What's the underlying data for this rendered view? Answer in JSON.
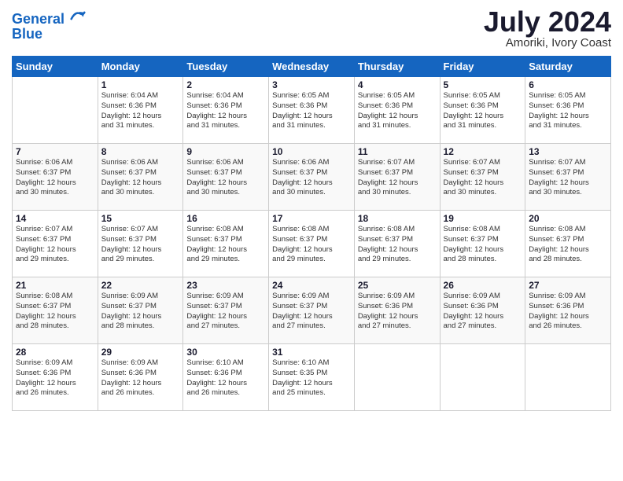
{
  "header": {
    "logo_line1": "General",
    "logo_line2": "Blue",
    "month_year": "July 2024",
    "location": "Amoriki, Ivory Coast"
  },
  "weekdays": [
    "Sunday",
    "Monday",
    "Tuesday",
    "Wednesday",
    "Thursday",
    "Friday",
    "Saturday"
  ],
  "weeks": [
    [
      {
        "day": "",
        "info": ""
      },
      {
        "day": "1",
        "info": "Sunrise: 6:04 AM\nSunset: 6:36 PM\nDaylight: 12 hours\nand 31 minutes."
      },
      {
        "day": "2",
        "info": "Sunrise: 6:04 AM\nSunset: 6:36 PM\nDaylight: 12 hours\nand 31 minutes."
      },
      {
        "day": "3",
        "info": "Sunrise: 6:05 AM\nSunset: 6:36 PM\nDaylight: 12 hours\nand 31 minutes."
      },
      {
        "day": "4",
        "info": "Sunrise: 6:05 AM\nSunset: 6:36 PM\nDaylight: 12 hours\nand 31 minutes."
      },
      {
        "day": "5",
        "info": "Sunrise: 6:05 AM\nSunset: 6:36 PM\nDaylight: 12 hours\nand 31 minutes."
      },
      {
        "day": "6",
        "info": "Sunrise: 6:05 AM\nSunset: 6:36 PM\nDaylight: 12 hours\nand 31 minutes."
      }
    ],
    [
      {
        "day": "7",
        "info": "Sunrise: 6:06 AM\nSunset: 6:37 PM\nDaylight: 12 hours\nand 30 minutes."
      },
      {
        "day": "8",
        "info": "Sunrise: 6:06 AM\nSunset: 6:37 PM\nDaylight: 12 hours\nand 30 minutes."
      },
      {
        "day": "9",
        "info": "Sunrise: 6:06 AM\nSunset: 6:37 PM\nDaylight: 12 hours\nand 30 minutes."
      },
      {
        "day": "10",
        "info": "Sunrise: 6:06 AM\nSunset: 6:37 PM\nDaylight: 12 hours\nand 30 minutes."
      },
      {
        "day": "11",
        "info": "Sunrise: 6:07 AM\nSunset: 6:37 PM\nDaylight: 12 hours\nand 30 minutes."
      },
      {
        "day": "12",
        "info": "Sunrise: 6:07 AM\nSunset: 6:37 PM\nDaylight: 12 hours\nand 30 minutes."
      },
      {
        "day": "13",
        "info": "Sunrise: 6:07 AM\nSunset: 6:37 PM\nDaylight: 12 hours\nand 30 minutes."
      }
    ],
    [
      {
        "day": "14",
        "info": "Sunrise: 6:07 AM\nSunset: 6:37 PM\nDaylight: 12 hours\nand 29 minutes."
      },
      {
        "day": "15",
        "info": "Sunrise: 6:07 AM\nSunset: 6:37 PM\nDaylight: 12 hours\nand 29 minutes."
      },
      {
        "day": "16",
        "info": "Sunrise: 6:08 AM\nSunset: 6:37 PM\nDaylight: 12 hours\nand 29 minutes."
      },
      {
        "day": "17",
        "info": "Sunrise: 6:08 AM\nSunset: 6:37 PM\nDaylight: 12 hours\nand 29 minutes."
      },
      {
        "day": "18",
        "info": "Sunrise: 6:08 AM\nSunset: 6:37 PM\nDaylight: 12 hours\nand 29 minutes."
      },
      {
        "day": "19",
        "info": "Sunrise: 6:08 AM\nSunset: 6:37 PM\nDaylight: 12 hours\nand 28 minutes."
      },
      {
        "day": "20",
        "info": "Sunrise: 6:08 AM\nSunset: 6:37 PM\nDaylight: 12 hours\nand 28 minutes."
      }
    ],
    [
      {
        "day": "21",
        "info": "Sunrise: 6:08 AM\nSunset: 6:37 PM\nDaylight: 12 hours\nand 28 minutes."
      },
      {
        "day": "22",
        "info": "Sunrise: 6:09 AM\nSunset: 6:37 PM\nDaylight: 12 hours\nand 28 minutes."
      },
      {
        "day": "23",
        "info": "Sunrise: 6:09 AM\nSunset: 6:37 PM\nDaylight: 12 hours\nand 27 minutes."
      },
      {
        "day": "24",
        "info": "Sunrise: 6:09 AM\nSunset: 6:37 PM\nDaylight: 12 hours\nand 27 minutes."
      },
      {
        "day": "25",
        "info": "Sunrise: 6:09 AM\nSunset: 6:36 PM\nDaylight: 12 hours\nand 27 minutes."
      },
      {
        "day": "26",
        "info": "Sunrise: 6:09 AM\nSunset: 6:36 PM\nDaylight: 12 hours\nand 27 minutes."
      },
      {
        "day": "27",
        "info": "Sunrise: 6:09 AM\nSunset: 6:36 PM\nDaylight: 12 hours\nand 26 minutes."
      }
    ],
    [
      {
        "day": "28",
        "info": "Sunrise: 6:09 AM\nSunset: 6:36 PM\nDaylight: 12 hours\nand 26 minutes."
      },
      {
        "day": "29",
        "info": "Sunrise: 6:09 AM\nSunset: 6:36 PM\nDaylight: 12 hours\nand 26 minutes."
      },
      {
        "day": "30",
        "info": "Sunrise: 6:10 AM\nSunset: 6:36 PM\nDaylight: 12 hours\nand 26 minutes."
      },
      {
        "day": "31",
        "info": "Sunrise: 6:10 AM\nSunset: 6:35 PM\nDaylight: 12 hours\nand 25 minutes."
      },
      {
        "day": "",
        "info": ""
      },
      {
        "day": "",
        "info": ""
      },
      {
        "day": "",
        "info": ""
      }
    ]
  ]
}
